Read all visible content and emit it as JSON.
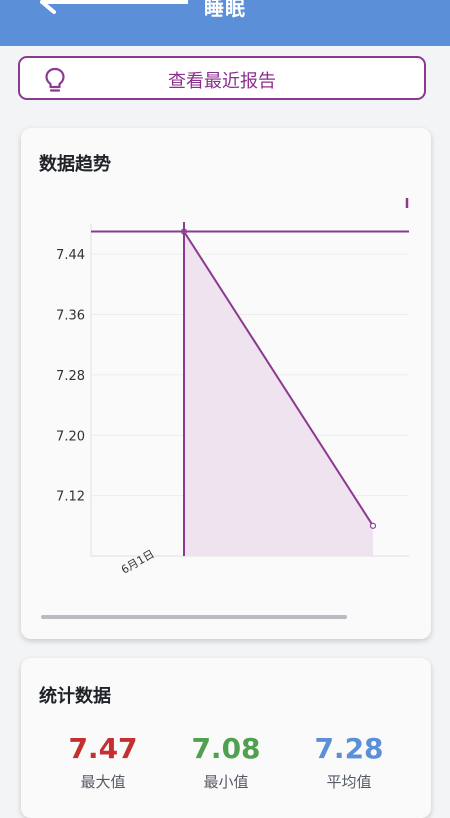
{
  "header": {
    "title": "睡眠"
  },
  "report_button": {
    "label": "查看最近报告"
  },
  "trend_card": {
    "title": "数据趋势"
  },
  "chart_data": {
    "type": "area",
    "x_categories": [
      "6月1日"
    ],
    "series": [
      {
        "x": [
          "6月1日",
          ""
        ],
        "values": [
          7.47,
          7.08
        ]
      }
    ],
    "y_ticks": [
      7.44,
      7.36,
      7.28,
      7.2,
      7.12
    ],
    "y_tick_labels": [
      "7.44",
      "7.36",
      "7.28",
      "7.20",
      "7.12"
    ],
    "ylim": [
      7.04,
      7.48
    ],
    "crosshair": {
      "x": "6月1日",
      "y": 7.47
    },
    "grid": true,
    "color": "#8b3a8f",
    "fill_color": "#efe3f0"
  },
  "stats_card": {
    "title": "统计数据",
    "items": [
      {
        "value": "7.47",
        "label": "最大值",
        "color": "#c62f2f"
      },
      {
        "value": "7.08",
        "label": "最小值",
        "color": "#4fa04f"
      },
      {
        "value": "7.28",
        "label": "平均值",
        "color": "#5b8fd8"
      }
    ]
  },
  "icons": {
    "back": "back-arrow-icon",
    "bulb": "lightbulb-icon"
  }
}
